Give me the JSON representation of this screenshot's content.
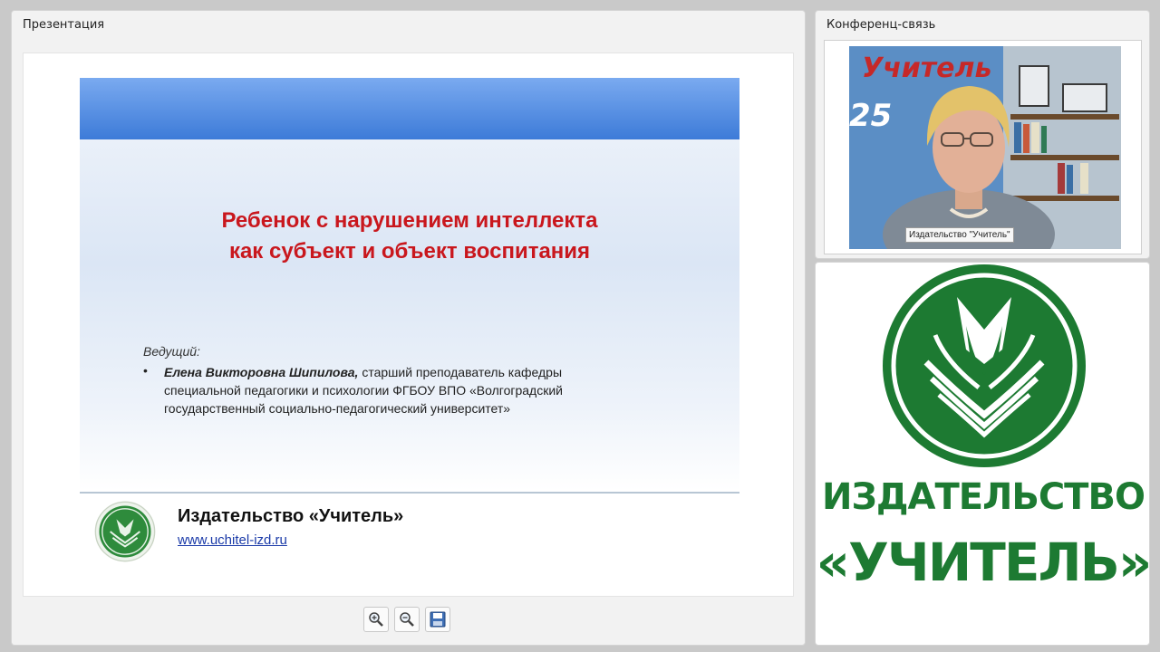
{
  "presentation": {
    "panel_title": "Презентация",
    "slide": {
      "title_line1": "Ребенок с нарушением интеллекта",
      "title_line2": "как субъект и объект воспитания",
      "presenter_label": "Ведущий:",
      "bullet": "•",
      "presenter_name": "Елена Викторовна Шипилова,",
      "presenter_desc": " старший преподаватель кафедры специальной педагогики и психологии ФГБОУ ВПО «Волгоградский государственный социально-педагогический университет»",
      "publisher_name": "Издательство «Учитель»",
      "publisher_url": "www.uchitel-izd.ru",
      "accent_color": "#c9171d"
    },
    "toolbar": [
      {
        "icon": "zoom-in-icon"
      },
      {
        "icon": "zoom-out-icon"
      },
      {
        "icon": "save-icon"
      }
    ]
  },
  "conference": {
    "panel_title": "Конференц-связь",
    "participant_label": "Издательство \"Учитель\"",
    "background_text": "Учитель"
  },
  "brand": {
    "line1": "ИЗДАТЕЛЬСТВО",
    "line2": "«УЧИТЕЛЬ»",
    "color": "#1d7a32"
  }
}
